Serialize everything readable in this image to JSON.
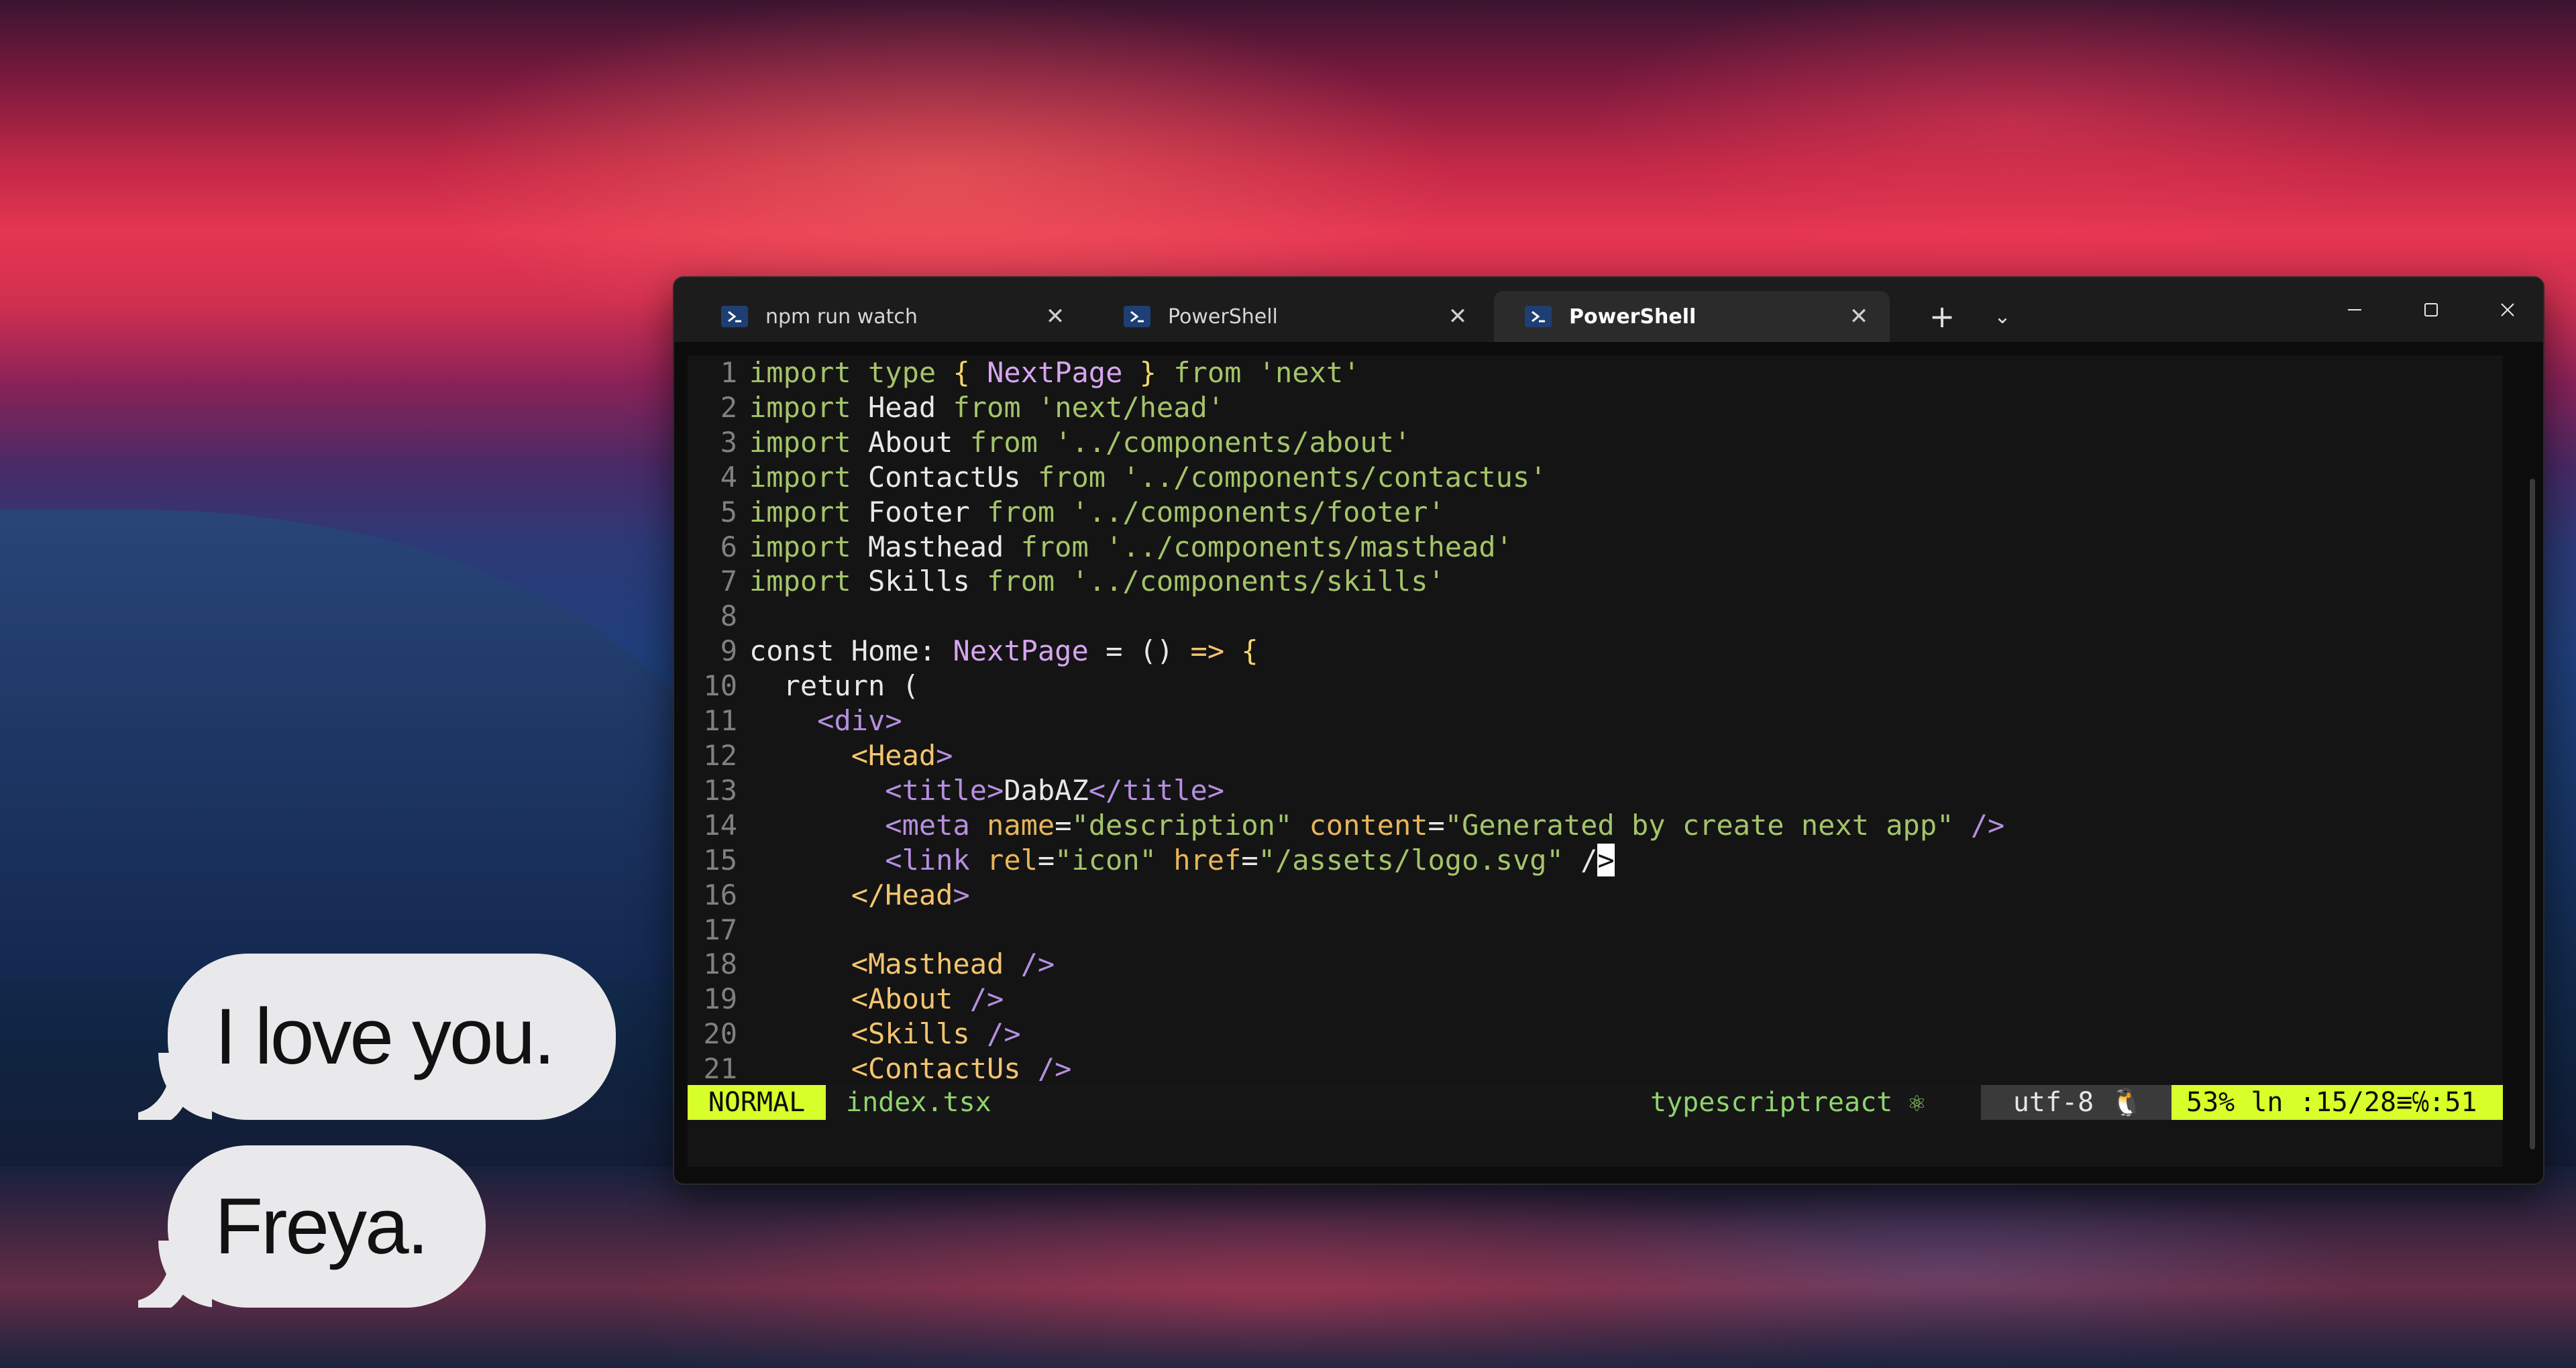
{
  "chat": {
    "bubble1": "I love you.",
    "bubble2": "Freya."
  },
  "tabs": [
    {
      "label": "npm run watch",
      "icon": "powershell-icon",
      "active": false
    },
    {
      "label": "PowerShell",
      "icon": "powershell-icon",
      "active": false
    },
    {
      "label": "PowerShell",
      "icon": "powershell-icon",
      "active": true
    }
  ],
  "tab_close_glyph": "✕",
  "new_tab_glyph": "+",
  "dropdown_glyph": "⌄",
  "window_controls": {
    "minimize": "—",
    "maximize": "▢",
    "close": "✕"
  },
  "editor": {
    "lines": [
      "import type { NextPage } from 'next'",
      "import Head from 'next/head'",
      "import About from '../components/about'",
      "import ContactUs from '../components/contactus'",
      "import Footer from '../components/footer'",
      "import Masthead from '../components/masthead'",
      "import Skills from '../components/skills'",
      "",
      "const Home: NextPage = () => {",
      "  return (",
      "    <div>",
      "      <Head>",
      "        <title>DabAZ</title>",
      "        <meta name=\"description\" content=\"Generated by create next app\" />",
      "        <link rel=\"icon\" href=\"/assets/logo.svg\" />",
      "      </Head>",
      "",
      "      <Masthead />",
      "      <About />",
      "      <Skills />",
      "      <ContactUs />"
    ],
    "cursor_line": 15
  },
  "statusline": {
    "mode": "NORMAL",
    "filename": "index.tsx",
    "filetype": "typescriptreact ⚛",
    "encoding": "utf-8 🐧",
    "position": "53%  ln :15/28≡℅:51"
  },
  "colors": {
    "mode_bg": "#d7ff2a",
    "string": "#a4c46a",
    "type": "#d7a5f0",
    "bracket": "#f3d46f"
  }
}
